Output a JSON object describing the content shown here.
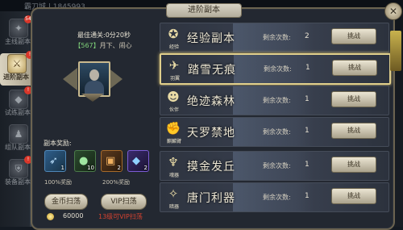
{
  "top_banner": "霸刀城 | 1845993",
  "window_title": "进阶副本",
  "close_symbol": "✕",
  "sidebar": {
    "items": [
      {
        "label": "主线副本",
        "badge": "54",
        "active": false,
        "icon": "scroll-icon"
      },
      {
        "label": "进阶副本",
        "badge": "!",
        "active": true,
        "icon": "sword-icon"
      },
      {
        "label": "试练副本",
        "badge": "!",
        "active": false,
        "icon": "shield-icon"
      },
      {
        "label": "组队副本",
        "badge": "",
        "active": false,
        "icon": "team-icon"
      },
      {
        "label": "装备副本",
        "badge": "!",
        "active": false,
        "icon": "armor-icon"
      }
    ]
  },
  "detail": {
    "best_clear": "最佳通关:0分20秒",
    "level_tag": "【567】",
    "location": "月下、闹心",
    "rewards_title": "副本奖励:",
    "rewards": [
      {
        "icon": "feather-icon",
        "count": "1",
        "color": "#4f87b8"
      },
      {
        "icon": "orb-icon",
        "count": "10",
        "color": "#4b7a4a"
      },
      {
        "icon": "chest-icon",
        "count": "2",
        "color": "#a66a2a"
      },
      {
        "icon": "gem-icon",
        "count": "2",
        "color": "#7b5cd4"
      }
    ],
    "gold_reward_pct": "100%奖励",
    "vip_reward_pct": "200%奖励",
    "gold_sweep_label": "金币扫荡",
    "vip_sweep_label": "VIP扫荡",
    "gold_amount": "60000",
    "vip_note": "13级可VIP扫荡"
  },
  "dungeons": [
    {
      "name": "经验副本",
      "tag": "经验",
      "remaining_label": "剩余次数:",
      "remaining": "2",
      "button": "挑战",
      "selected": false,
      "icon": "exp-icon"
    },
    {
      "name": "踏雪无痕",
      "tag": "羽翼",
      "remaining_label": "剩余次数:",
      "remaining": "1",
      "button": "挑战",
      "selected": true,
      "icon": "wing-icon"
    },
    {
      "name": "绝迹森林",
      "tag": "伙伴",
      "remaining_label": "剩余次数:",
      "remaining": "1",
      "button": "挑战",
      "selected": false,
      "icon": "partner-icon"
    },
    {
      "name": "天罗禁地",
      "tag": "麒麟臂",
      "remaining_label": "剩余次数:",
      "remaining": "1",
      "button": "挑战",
      "selected": false,
      "icon": "arm-icon"
    },
    {
      "name": "摸金发丘",
      "tag": "魂器",
      "remaining_label": "剩余次数:",
      "remaining": "1",
      "button": "挑战",
      "selected": false,
      "icon": "soul-icon"
    },
    {
      "name": "唐门利器",
      "tag": "暗器",
      "remaining_label": "剩余次数:",
      "remaining": "1",
      "button": "挑战",
      "selected": false,
      "icon": "dart-icon"
    }
  ]
}
